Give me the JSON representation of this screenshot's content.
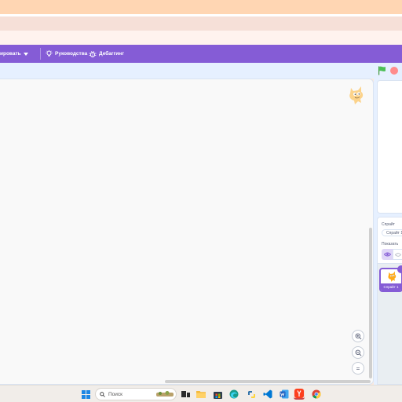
{
  "menubar": {
    "file_menu_label": "ировать",
    "tutorials_label": "Руководства",
    "debug_label": "Дебаггинг"
  },
  "sprite_info": {
    "sprite_label": "Спрайт",
    "sprite_name_value": "Спрайт 1",
    "show_label": "Показать"
  },
  "sprite_list": {
    "items": [
      {
        "name": "Спрайт 1"
      }
    ]
  },
  "zoom_controls": {
    "zoom_in_icon": "zoom-in-icon",
    "zoom_out_icon": "zoom-out-icon",
    "reset_label": "="
  },
  "taskbar": {
    "search_placeholder": "Поиск"
  },
  "colors": {
    "accent": "#855cd6",
    "stage_header": "#e6f0ff",
    "go_flag": "#4cbf56",
    "stop": "#ff8c8c"
  }
}
